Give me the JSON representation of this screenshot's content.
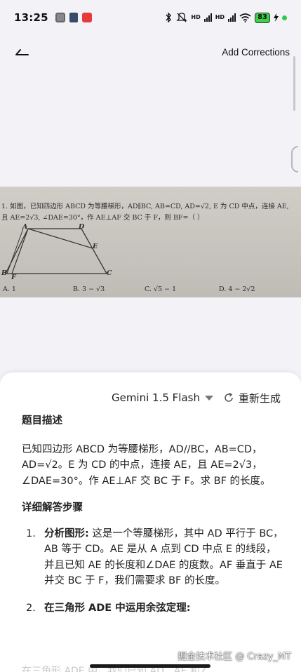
{
  "status_bar": {
    "time": "13:25",
    "battery": "83",
    "icons": [
      "photo-app-icon",
      "mascot-icon",
      "record-icon",
      "bluetooth-icon",
      "mute-icon",
      "signal-icon",
      "wifi-icon",
      "battery-icon",
      "charging-icon"
    ],
    "hd1": "HD",
    "hd2": "HD"
  },
  "header": {
    "add_corrections": "Add Corrections"
  },
  "photo": {
    "line1": "1. 如图，已知四边形 ABCD 为等腰梯形，AD∥BC, AB=CD, AD=√2, E 为 CD 中点，连接 AE,",
    "line2": "且 AE=2√3, ∠DAE=30°，作 AE⊥AF 交 BC 于 F，则 BF=（      ）",
    "labels": {
      "A": "A",
      "B": "B",
      "C": "C",
      "D": "D",
      "E": "E",
      "F": "F"
    },
    "options": [
      "A. 1",
      "B. 3 − √3",
      "C. √5 − 1",
      "D. 4 − 2√2"
    ]
  },
  "sheet": {
    "model": "Gemini 1.5 Flash",
    "regenerate": "重新生成",
    "heading1": "题目描述",
    "description": "已知四边形 ABCD 为等腰梯形，AD//BC，AB=CD，AD=√2。E 为 CD 的中点，连接 AE，且 AE=2√3，∠DAE=30°。作 AE⊥AF 交 BC 于 F。求 BF 的长度。",
    "heading2": "详细解答步骤",
    "steps": [
      {
        "num": "1.",
        "title": "分析图形:",
        "body": " 这是一个等腰梯形，其中 AD 平行于 BC，AB 等于 CD。AE 是从 A 点到 CD 中点 E 的线段，并且已知 AE 的长度和∠DAE 的度数。AF 垂直于 AE 并交 BC 于 F，我们需要求 BF 的长度。"
      },
      {
        "num": "2.",
        "title": "在三角形 ADE 中运用余弦定理:",
        "body": ""
      }
    ],
    "faded_text": "在三角形 ADE 中，我们已知 AD、AE 和∠"
  },
  "watermark": "掘金技术社区 @ Crazy_MT"
}
